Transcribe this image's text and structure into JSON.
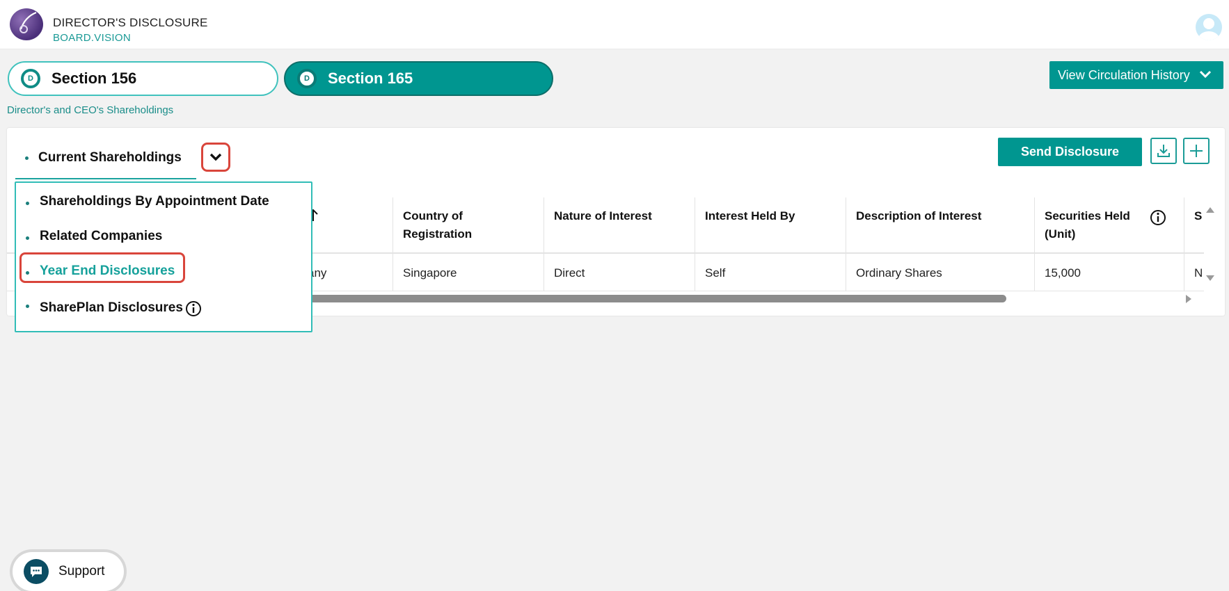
{
  "header": {
    "app_title": "DIRECTOR'S DISCLOSURE",
    "brand": "BOARD.VISION",
    "logo_icon": "feather-logo-icon",
    "avatar_icon": "user-avatar-icon"
  },
  "tabs": [
    {
      "badge": "D",
      "label": "Section 156",
      "active": false
    },
    {
      "badge": "D",
      "label": "Section 165",
      "active": true
    }
  ],
  "subtitle": "Director's and CEO's Shareholdings",
  "view_circulation_label": "View Circulation History",
  "toolbar": {
    "current_view": "Current Shareholdings",
    "send_label": "Send Disclosure",
    "download_icon": "download-icon",
    "add_icon": "plus-icon"
  },
  "dropdown": {
    "items": [
      {
        "label": "Shareholdings By Appointment Date"
      },
      {
        "label": "Related Companies"
      },
      {
        "label": "Year End Disclosures"
      },
      {
        "label": "SharePlan Disclosures"
      }
    ],
    "selected_index": 2
  },
  "table": {
    "headers": [
      "Country of Registration",
      "Nature of Interest",
      "Interest Held By",
      "Description of Interest",
      "Securities Held (Unit)",
      "S"
    ],
    "partial_first_cell": "any",
    "rows": [
      [
        "Singapore",
        "Direct",
        "Self",
        "Ordinary Shares",
        "15,000",
        "N"
      ]
    ]
  },
  "support": {
    "label": "Support",
    "icon": "chat-bubble-icon"
  },
  "colors": {
    "accent": "#009690",
    "accent_light": "#31bdb7",
    "highlight": "#d9453b"
  }
}
